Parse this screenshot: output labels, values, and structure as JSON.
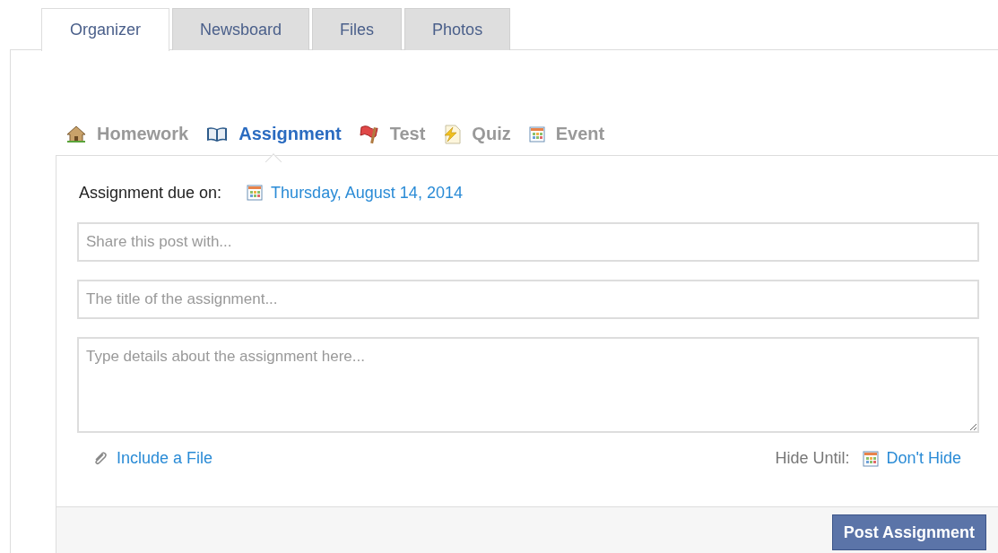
{
  "tabs": [
    {
      "label": "Organizer",
      "selected": true
    },
    {
      "label": "Newsboard",
      "selected": false
    },
    {
      "label": "Files",
      "selected": false
    },
    {
      "label": "Photos",
      "selected": false
    }
  ],
  "post_types": [
    {
      "kind": "homework",
      "label": "Homework",
      "selected": false
    },
    {
      "kind": "assignment",
      "label": "Assignment",
      "selected": true
    },
    {
      "kind": "test",
      "label": "Test",
      "selected": false
    },
    {
      "kind": "quiz",
      "label": "Quiz",
      "selected": false
    },
    {
      "kind": "event",
      "label": "Event",
      "selected": false
    }
  ],
  "due": {
    "label": "Assignment due on:",
    "date": "Thursday, August 14, 2014"
  },
  "share_field": {
    "placeholder": "Share this post with..."
  },
  "title_field": {
    "placeholder": "The title of the assignment..."
  },
  "details_field": {
    "placeholder": "Type details about the assignment here..."
  },
  "attach_link": "Include a File",
  "hide_until": {
    "label": "Hide Until:",
    "value": "Don't Hide"
  },
  "submit_button": "Post Assignment"
}
